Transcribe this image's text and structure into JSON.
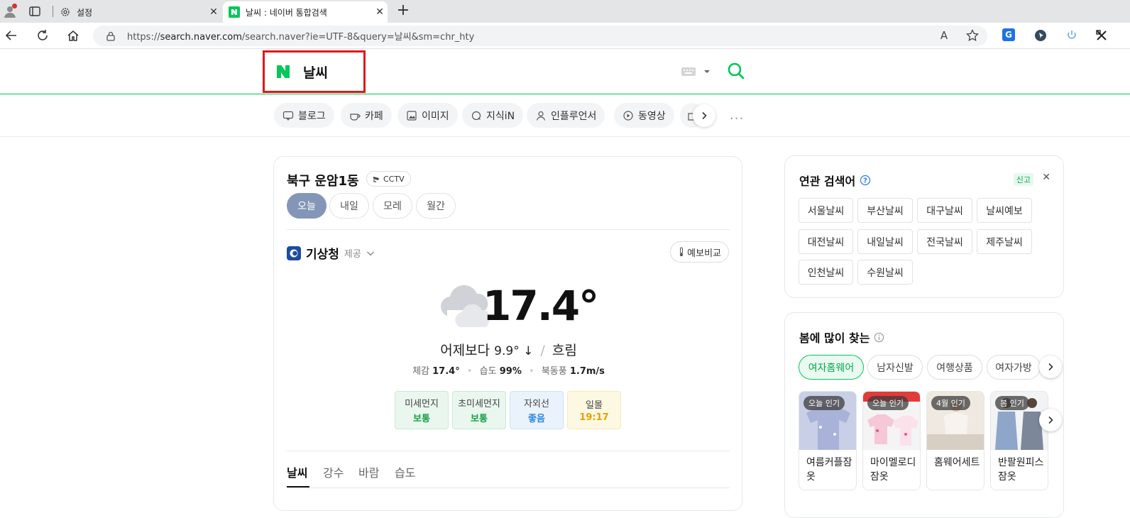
{
  "browser": {
    "tabs": [
      {
        "title": "설정",
        "icon": "gear-icon"
      },
      {
        "title": "날씨 : 네이버 통합검색",
        "icon": "naver-favicon"
      }
    ],
    "close_glyph": "✕",
    "new_tab_glyph": "+",
    "url_prefix": "https://",
    "url_host": "search.naver.com",
    "url_rest": "/search.naver?ie=UTF-8&query=날씨&sm=chr_hty",
    "reader_glyph": "A",
    "extension_g_label": "G"
  },
  "header": {
    "query": "날씨",
    "highlight_color": "#e0171b",
    "brand_color": "#03c75a"
  },
  "categories": [
    {
      "label": "블로그",
      "icon": "blog-icon"
    },
    {
      "label": "카페",
      "icon": "cafe-icon"
    },
    {
      "label": "이미지",
      "icon": "image-icon"
    },
    {
      "label": "지식iN",
      "icon": "kin-icon"
    },
    {
      "label": "인플루언서",
      "icon": "person-icon"
    },
    {
      "label": "동영상",
      "icon": "video-icon"
    }
  ],
  "more_glyph": "···",
  "weather": {
    "location": "북구 운암1동",
    "cctv_label": "CCTV",
    "day_tabs": [
      "오늘",
      "내일",
      "모레",
      "월간"
    ],
    "provider": "기상청",
    "provider_sub": "제공",
    "compare_label": "예보비교",
    "temperature": "17.4°",
    "compare_text": "어제보다",
    "compare_value": "9.9° ↓",
    "condition": "흐림",
    "feels_label": "체감",
    "feels_value": "17.4°",
    "humidity_label": "습도",
    "humidity_value": "99%",
    "wind_label": "북동풍",
    "wind_value": "1.7m/s",
    "air": [
      {
        "label": "미세먼지",
        "value": "보통",
        "bg": "#eaf7ee",
        "border": "#c9ead4",
        "color": "#1a9e47"
      },
      {
        "label": "초미세먼지",
        "value": "보통",
        "bg": "#eaf7ee",
        "border": "#c9ead4",
        "color": "#1a9e47"
      },
      {
        "label": "자외선",
        "value": "좋음",
        "bg": "#eaf3fc",
        "border": "#cfe2f6",
        "color": "#2f86de"
      },
      {
        "label": "일몰",
        "value": "19:17",
        "bg": "#fdf8e1",
        "border": "#f3ebbd",
        "color": "#e6a100"
      }
    ],
    "bottom_tabs": [
      "날씨",
      "강수",
      "바람",
      "습도"
    ]
  },
  "related": {
    "title": "연관 검색어",
    "report_label": "신고",
    "close_glyph": "✕",
    "keywords": [
      "서울날씨",
      "부산날씨",
      "대구날씨",
      "날씨예보",
      "대전날씨",
      "내일날씨",
      "전국날씨",
      "제주날씨",
      "인천날씨",
      "수원날씨"
    ]
  },
  "spring": {
    "title": "봄에 많이 찾는",
    "filters": [
      "여자홈웨어",
      "남자신발",
      "여행상품",
      "여자가방"
    ],
    "products": [
      {
        "badge": "오늘 인기",
        "name": "여름커플잠옷"
      },
      {
        "badge": "오늘 인기",
        "name": "마이멜로디잠옷"
      },
      {
        "badge": "4월 인기",
        "name": "홈웨어세트"
      },
      {
        "badge": "봄 인기",
        "name": "반팔원피스잠옷"
      }
    ]
  }
}
